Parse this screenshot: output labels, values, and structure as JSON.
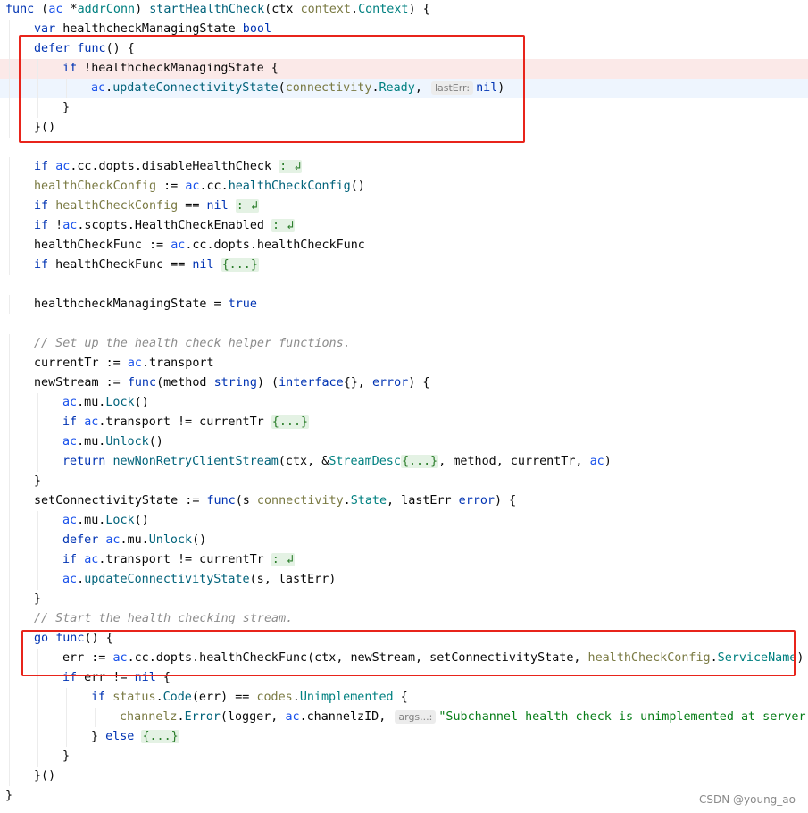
{
  "editor": {
    "lines": [
      {
        "indent": 0,
        "tokens": [
          {
            "t": "func",
            "c": "kw"
          },
          {
            "t": " ("
          },
          {
            "t": "ac",
            "c": "recv"
          },
          {
            "t": " *"
          },
          {
            "t": "addrConn",
            "c": "type"
          },
          {
            "t": ") "
          },
          {
            "t": "startHealthCheck",
            "c": "fn"
          },
          {
            "t": "(ctx "
          },
          {
            "t": "context",
            "c": "pkg"
          },
          {
            "t": "."
          },
          {
            "t": "Context",
            "c": "type"
          },
          {
            "t": ") {"
          }
        ]
      },
      {
        "indent": 1,
        "tokens": [
          {
            "t": "var",
            "c": "kw"
          },
          {
            "t": " healthcheckManagingState "
          },
          {
            "t": "bool",
            "c": "kw"
          }
        ]
      },
      {
        "indent": 1,
        "tokens": [
          {
            "t": "defer",
            "c": "kw"
          },
          {
            "t": " "
          },
          {
            "t": "func",
            "c": "kw"
          },
          {
            "t": "() {"
          }
        ]
      },
      {
        "indent": 2,
        "hl": "pink",
        "tokens": [
          {
            "t": "if",
            "c": "kw"
          },
          {
            "t": " !healthcheckManagingState {"
          }
        ]
      },
      {
        "indent": 3,
        "hl": "blue",
        "tokens": [
          {
            "t": "ac",
            "c": "recv"
          },
          {
            "t": "."
          },
          {
            "t": "updateConnectivityState",
            "c": "fn"
          },
          {
            "t": "("
          },
          {
            "t": "connectivity",
            "c": "pkg"
          },
          {
            "t": "."
          },
          {
            "t": "Ready",
            "c": "type"
          },
          {
            "t": ", "
          },
          {
            "t": "lastErr:",
            "c": "hint"
          },
          {
            "t": "nil",
            "c": "kw"
          },
          {
            "t": ")"
          }
        ]
      },
      {
        "indent": 2,
        "tokens": [
          {
            "t": "}"
          }
        ]
      },
      {
        "indent": 1,
        "tokens": [
          {
            "t": "}()"
          }
        ]
      },
      {
        "indent": 0,
        "tokens": []
      },
      {
        "indent": 1,
        "tokens": [
          {
            "t": "if",
            "c": "kw"
          },
          {
            "t": " "
          },
          {
            "t": "ac",
            "c": "recv"
          },
          {
            "t": ".cc.dopts.disableHealthCheck "
          },
          {
            "t": ": ↲",
            "c": "fold"
          }
        ]
      },
      {
        "indent": 1,
        "tokens": [
          {
            "t": "healthCheckConfig",
            "c": "pkg"
          },
          {
            "t": " := "
          },
          {
            "t": "ac",
            "c": "recv"
          },
          {
            "t": ".cc."
          },
          {
            "t": "healthCheckConfig",
            "c": "fn"
          },
          {
            "t": "()"
          }
        ]
      },
      {
        "indent": 1,
        "tokens": [
          {
            "t": "if",
            "c": "kw"
          },
          {
            "t": " "
          },
          {
            "t": "healthCheckConfig",
            "c": "pkg"
          },
          {
            "t": " == "
          },
          {
            "t": "nil",
            "c": "kw"
          },
          {
            "t": " "
          },
          {
            "t": ": ↲",
            "c": "fold"
          }
        ]
      },
      {
        "indent": 1,
        "tokens": [
          {
            "t": "if",
            "c": "kw"
          },
          {
            "t": " !"
          },
          {
            "t": "ac",
            "c": "recv"
          },
          {
            "t": ".scopts.HealthCheckEnabled "
          },
          {
            "t": ": ↲",
            "c": "fold"
          }
        ]
      },
      {
        "indent": 1,
        "tokens": [
          {
            "t": "healthCheckFunc := "
          },
          {
            "t": "ac",
            "c": "recv"
          },
          {
            "t": ".cc.dopts.healthCheckFunc"
          }
        ]
      },
      {
        "indent": 1,
        "tokens": [
          {
            "t": "if",
            "c": "kw"
          },
          {
            "t": " healthCheckFunc == "
          },
          {
            "t": "nil",
            "c": "kw"
          },
          {
            "t": " "
          },
          {
            "t": "{...}",
            "c": "fold"
          }
        ]
      },
      {
        "indent": 0,
        "tokens": []
      },
      {
        "indent": 1,
        "tokens": [
          {
            "t": "healthcheckManagingState = "
          },
          {
            "t": "true",
            "c": "kw"
          }
        ]
      },
      {
        "indent": 0,
        "tokens": []
      },
      {
        "indent": 1,
        "tokens": [
          {
            "t": "// Set up the health check helper functions.",
            "c": "cmt"
          }
        ]
      },
      {
        "indent": 1,
        "tokens": [
          {
            "t": "currentTr := "
          },
          {
            "t": "ac",
            "c": "recv"
          },
          {
            "t": ".transport"
          }
        ]
      },
      {
        "indent": 1,
        "tokens": [
          {
            "t": "newStream := "
          },
          {
            "t": "func",
            "c": "kw"
          },
          {
            "t": "(method "
          },
          {
            "t": "string",
            "c": "kw"
          },
          {
            "t": ") ("
          },
          {
            "t": "interface",
            "c": "kw"
          },
          {
            "t": "{}, "
          },
          {
            "t": "error",
            "c": "kw"
          },
          {
            "t": ") {"
          }
        ]
      },
      {
        "indent": 2,
        "tokens": [
          {
            "t": "ac",
            "c": "recv"
          },
          {
            "t": ".mu."
          },
          {
            "t": "Lock",
            "c": "fn"
          },
          {
            "t": "()"
          }
        ]
      },
      {
        "indent": 2,
        "tokens": [
          {
            "t": "if",
            "c": "kw"
          },
          {
            "t": " "
          },
          {
            "t": "ac",
            "c": "recv"
          },
          {
            "t": ".transport != currentTr "
          },
          {
            "t": "{...}",
            "c": "fold"
          }
        ]
      },
      {
        "indent": 2,
        "tokens": [
          {
            "t": "ac",
            "c": "recv"
          },
          {
            "t": ".mu."
          },
          {
            "t": "Unlock",
            "c": "fn"
          },
          {
            "t": "()"
          }
        ]
      },
      {
        "indent": 2,
        "tokens": [
          {
            "t": "return",
            "c": "kw"
          },
          {
            "t": " "
          },
          {
            "t": "newNonRetryClientStream",
            "c": "fn"
          },
          {
            "t": "(ctx, &"
          },
          {
            "t": "StreamDesc",
            "c": "type"
          },
          {
            "t": "{...}",
            "c": "fold"
          },
          {
            "t": ", method, currentTr, "
          },
          {
            "t": "ac",
            "c": "recv"
          },
          {
            "t": ")"
          }
        ]
      },
      {
        "indent": 1,
        "tokens": [
          {
            "t": "}"
          }
        ]
      },
      {
        "indent": 1,
        "tokens": [
          {
            "t": "setConnectivityState := "
          },
          {
            "t": "func",
            "c": "kw"
          },
          {
            "t": "(s "
          },
          {
            "t": "connectivity",
            "c": "pkg"
          },
          {
            "t": "."
          },
          {
            "t": "State",
            "c": "type"
          },
          {
            "t": ", lastErr "
          },
          {
            "t": "error",
            "c": "kw"
          },
          {
            "t": ") {"
          }
        ]
      },
      {
        "indent": 2,
        "tokens": [
          {
            "t": "ac",
            "c": "recv"
          },
          {
            "t": ".mu."
          },
          {
            "t": "Lock",
            "c": "fn"
          },
          {
            "t": "()"
          }
        ]
      },
      {
        "indent": 2,
        "tokens": [
          {
            "t": "defer",
            "c": "kw"
          },
          {
            "t": " "
          },
          {
            "t": "ac",
            "c": "recv"
          },
          {
            "t": ".mu."
          },
          {
            "t": "Unlock",
            "c": "fn"
          },
          {
            "t": "()"
          }
        ]
      },
      {
        "indent": 2,
        "tokens": [
          {
            "t": "if",
            "c": "kw"
          },
          {
            "t": " "
          },
          {
            "t": "ac",
            "c": "recv"
          },
          {
            "t": ".transport != currentTr "
          },
          {
            "t": ": ↲",
            "c": "fold"
          }
        ]
      },
      {
        "indent": 2,
        "tokens": [
          {
            "t": "ac",
            "c": "recv"
          },
          {
            "t": "."
          },
          {
            "t": "updateConnectivityState",
            "c": "fn"
          },
          {
            "t": "(s, lastErr)"
          }
        ]
      },
      {
        "indent": 1,
        "tokens": [
          {
            "t": "}"
          }
        ]
      },
      {
        "indent": 1,
        "tokens": [
          {
            "t": "// Start the health checking stream.",
            "c": "cmt"
          }
        ]
      },
      {
        "indent": 1,
        "tokens": [
          {
            "t": "go",
            "c": "kw"
          },
          {
            "t": " "
          },
          {
            "t": "func",
            "c": "kw"
          },
          {
            "t": "() {"
          }
        ]
      },
      {
        "indent": 2,
        "tokens": [
          {
            "t": "err := "
          },
          {
            "t": "ac",
            "c": "recv"
          },
          {
            "t": ".cc.dopts.healthCheckFunc(ctx, newStream, setConnectivityState, "
          },
          {
            "t": "healthCheckConfig",
            "c": "pkg"
          },
          {
            "t": "."
          },
          {
            "t": "ServiceName",
            "c": "type"
          },
          {
            "t": ")"
          }
        ]
      },
      {
        "indent": 2,
        "tokens": [
          {
            "t": "if",
            "c": "kw"
          },
          {
            "t": " err != "
          },
          {
            "t": "nil",
            "c": "kw"
          },
          {
            "t": " {"
          }
        ]
      },
      {
        "indent": 3,
        "tokens": [
          {
            "t": "if",
            "c": "kw"
          },
          {
            "t": " "
          },
          {
            "t": "status",
            "c": "pkg"
          },
          {
            "t": "."
          },
          {
            "t": "Code",
            "c": "fn"
          },
          {
            "t": "(err) == "
          },
          {
            "t": "codes",
            "c": "pkg"
          },
          {
            "t": "."
          },
          {
            "t": "Unimplemented",
            "c": "type"
          },
          {
            "t": " {"
          }
        ]
      },
      {
        "indent": 4,
        "tokens": [
          {
            "t": "channelz",
            "c": "pkg"
          },
          {
            "t": "."
          },
          {
            "t": "Error",
            "c": "fn"
          },
          {
            "t": "(logger, "
          },
          {
            "t": "ac",
            "c": "recv"
          },
          {
            "t": ".channelzID, "
          },
          {
            "t": "args...:",
            "c": "hint"
          },
          {
            "t": "\"Subchannel health check is unimplemented at server",
            "c": "str"
          }
        ]
      },
      {
        "indent": 3,
        "tokens": [
          {
            "t": "} "
          },
          {
            "t": "else",
            "c": "kw"
          },
          {
            "t": " "
          },
          {
            "t": "{...}",
            "c": "fold"
          }
        ]
      },
      {
        "indent": 2,
        "tokens": [
          {
            "t": "}"
          }
        ]
      },
      {
        "indent": 1,
        "tokens": [
          {
            "t": "}()"
          }
        ]
      },
      {
        "indent": 0,
        "tokens": [
          {
            "t": "}"
          }
        ]
      }
    ]
  },
  "watermark": "CSDN @young_ao"
}
